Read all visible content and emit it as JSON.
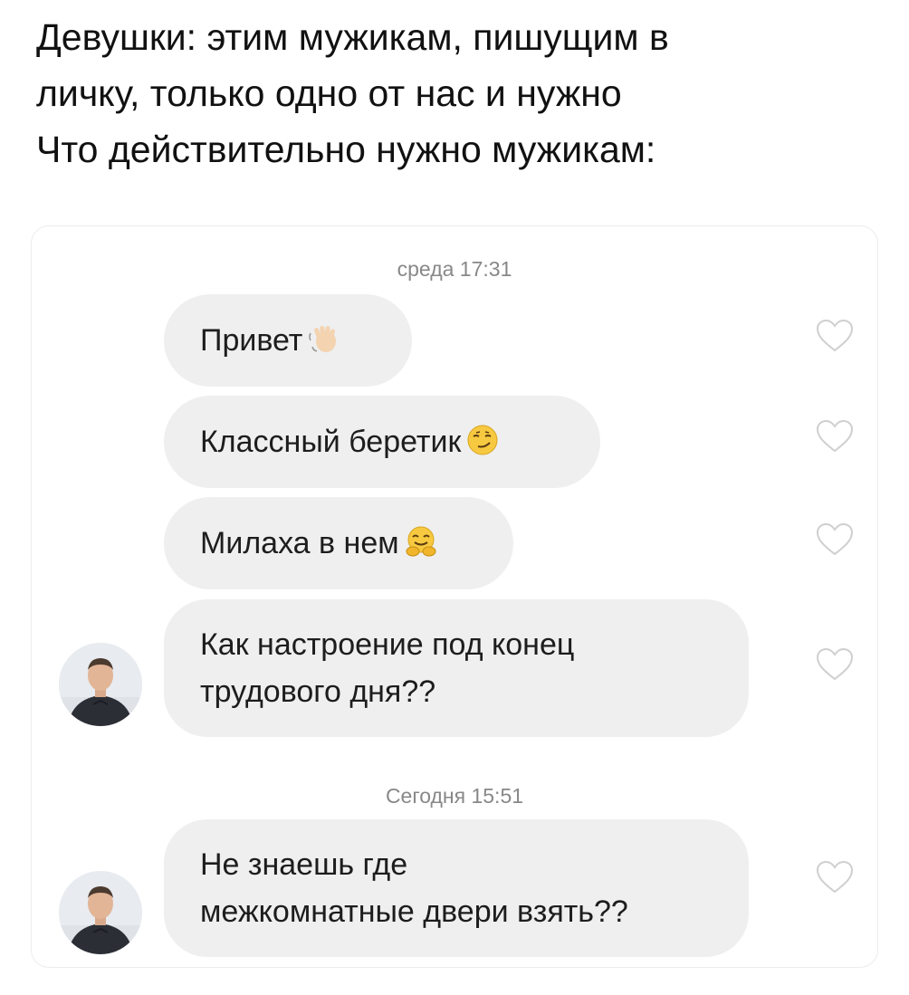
{
  "caption": {
    "lines": [
      "Девушки: этим мужикам, пишущим в",
      "личку, только одно от нас и нужно",
      "Что действительно нужно мужикам:"
    ]
  },
  "chat": {
    "timestamps": [
      "среда 17:31",
      "Сегодня 15:51"
    ],
    "messages": [
      {
        "text": "Привет",
        "emoji": "waving-hand-emoji"
      },
      {
        "text": "Классный беретик",
        "emoji": "smirking-face-emoji"
      },
      {
        "text": "Милаха в нем",
        "emoji": "hugging-face-emoji"
      },
      {
        "lines": [
          "Как настроение под конец",
          "трудового дня??"
        ],
        "avatar": true
      },
      {
        "lines": [
          "Не знаешь где",
          "межкомнатные двери взять??"
        ],
        "avatar": true
      }
    ],
    "icons": {
      "like": "heart-outline-icon",
      "avatar": "user-avatar-photo"
    },
    "colors": {
      "bubble": "#efefef",
      "timestamp": "#888888",
      "heart": "#cfcfcf"
    }
  }
}
